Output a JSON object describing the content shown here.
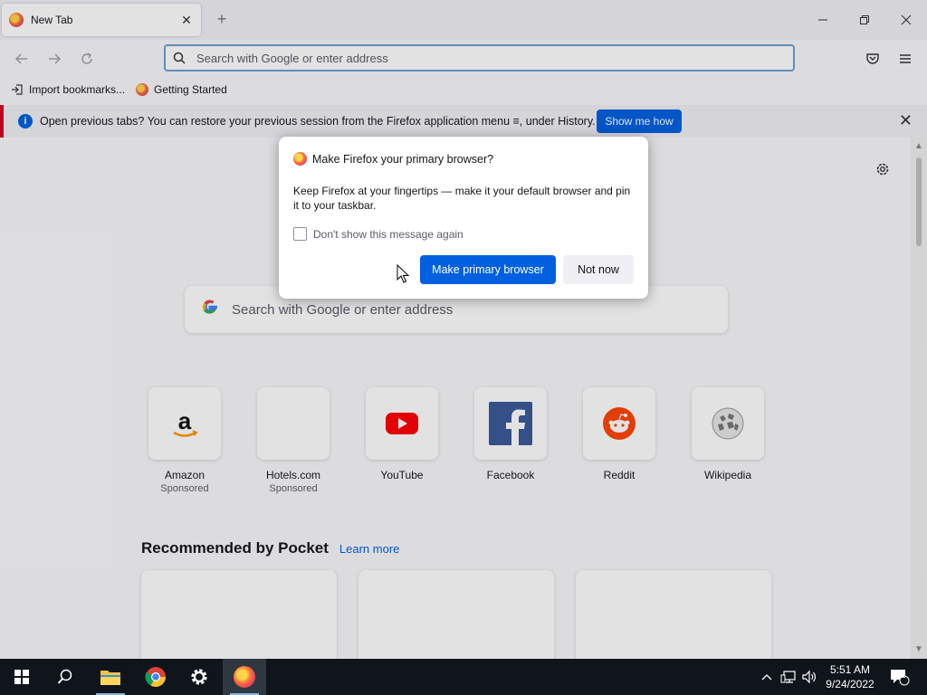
{
  "tab": {
    "title": "New Tab"
  },
  "urlbar": {
    "placeholder": "Search with Google or enter address"
  },
  "bookmarks": [
    {
      "label": "Import bookmarks...",
      "icon": "import-icon"
    },
    {
      "label": "Getting Started",
      "icon": "firefox-icon"
    }
  ],
  "infobar": {
    "message": "Open previous tabs? You can restore your previous session from the Firefox application menu ≡, under History.",
    "button": "Show me how"
  },
  "dialog": {
    "title": "Make Firefox your primary browser?",
    "body": "Keep Firefox at your fingertips — make it your default browser and pin it to your taskbar.",
    "checkbox": "Don't show this message again",
    "primary": "Make primary browser",
    "secondary": "Not now"
  },
  "search": {
    "placeholder": "Search with Google or enter address"
  },
  "tiles": [
    {
      "name": "Amazon",
      "sponsored": "Sponsored"
    },
    {
      "name": "Hotels.com",
      "sponsored": "Sponsored"
    },
    {
      "name": "YouTube",
      "sponsored": ""
    },
    {
      "name": "Facebook",
      "sponsored": ""
    },
    {
      "name": "Reddit",
      "sponsored": ""
    },
    {
      "name": "Wikipedia",
      "sponsored": ""
    }
  ],
  "pocket": {
    "title": "Recommended by Pocket",
    "link": "Learn more"
  },
  "clock": {
    "time": "5:51 AM",
    "date": "9/24/2022"
  },
  "notifications": {
    "count": "1"
  },
  "colors": {
    "accent": "#0060df",
    "infobar_stripe": "#d70022",
    "taskbar": "#10151c"
  }
}
